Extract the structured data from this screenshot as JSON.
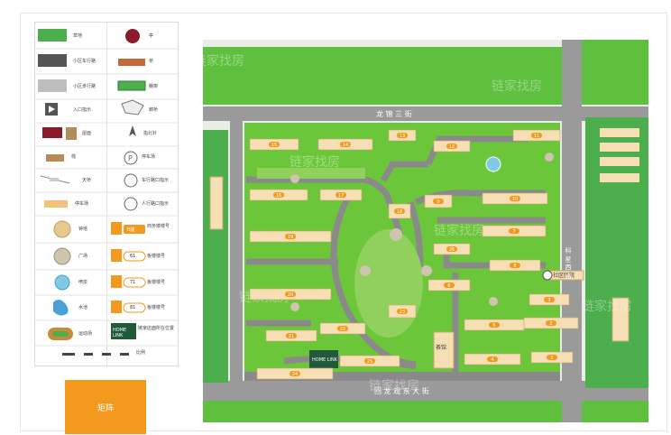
{
  "legend": {
    "items": [
      {
        "label": "草地",
        "icon": "grass-swatch"
      },
      {
        "label": "亭",
        "icon": "pavilion"
      },
      {
        "label": "小区车行路",
        "icon": "road-dark"
      },
      {
        "label": "桥",
        "icon": "bridge"
      },
      {
        "label": "小区步行路",
        "icon": "road-light"
      },
      {
        "label": "棚架",
        "icon": "pergola"
      },
      {
        "label": "入口指示",
        "icon": "entrance-arrow"
      },
      {
        "label": "廊桥",
        "icon": "corridor-bridge"
      },
      {
        "label": "屋面",
        "icon": "roof"
      },
      {
        "label": "指北针",
        "icon": "north-arrow"
      },
      {
        "label": "栈",
        "icon": "boardwalk"
      },
      {
        "label": "停车场",
        "icon": "parking-p"
      },
      {
        "label": "天桥",
        "icon": "sky-bridge"
      },
      {
        "label": "车行路口指示",
        "icon": "car-icon"
      },
      {
        "label": "停车场",
        "icon": "parking-area"
      },
      {
        "label": "人行路口指示",
        "icon": "pedestrian-icon"
      },
      {
        "label": "钟塔",
        "icon": "clock-tower"
      },
      {
        "label": "商务楼楼号",
        "icon": "commercial-badge"
      },
      {
        "label": "广场",
        "icon": "plaza"
      },
      {
        "label": "板楼楼号",
        "icon": "slab-badge-61"
      },
      {
        "label": "喷泉",
        "icon": "fountain"
      },
      {
        "label": "板楼楼号",
        "icon": "slab-badge-71"
      },
      {
        "label": "水池",
        "icon": "pool"
      },
      {
        "label": "板楼楼号",
        "icon": "slab-badge-81"
      },
      {
        "label": "运动场",
        "icon": "sports-field"
      },
      {
        "label": "链家店面所在位置",
        "icon": "homelink-store"
      }
    ],
    "badge_texts": {
      "b1": "B座",
      "b61": "61",
      "b71": "71",
      "b81": "81",
      "homelink": "HOME LINK"
    },
    "scale_label": "比例"
  },
  "orange_box_label": "矩阵",
  "map": {
    "streets": {
      "north": "龙 锦 三 街",
      "south": "回 龙 观 东 大 街",
      "east": "科 星 西 路"
    },
    "poi": {
      "hospital": "社区医院",
      "homelink": "HOME LINK",
      "teahouse": "茶馆"
    },
    "buildings": [
      "15",
      "14",
      "13",
      "12",
      "11",
      "16",
      "17",
      "18",
      "9",
      "10",
      "19",
      "7",
      "8",
      "6",
      "20",
      "3",
      "23",
      "5",
      "2",
      "21",
      "22",
      "4",
      "1",
      "24",
      "25",
      "26"
    ],
    "watermark": "链家找房"
  },
  "colors": {
    "grass": "#4cae4c",
    "bright_grass": "#6fd04a",
    "road": "#8a8a8a",
    "building": "#f6dfb4",
    "roof": "#8b1a2b",
    "badge": "#f39a1e",
    "sea": "#dce8d8"
  }
}
